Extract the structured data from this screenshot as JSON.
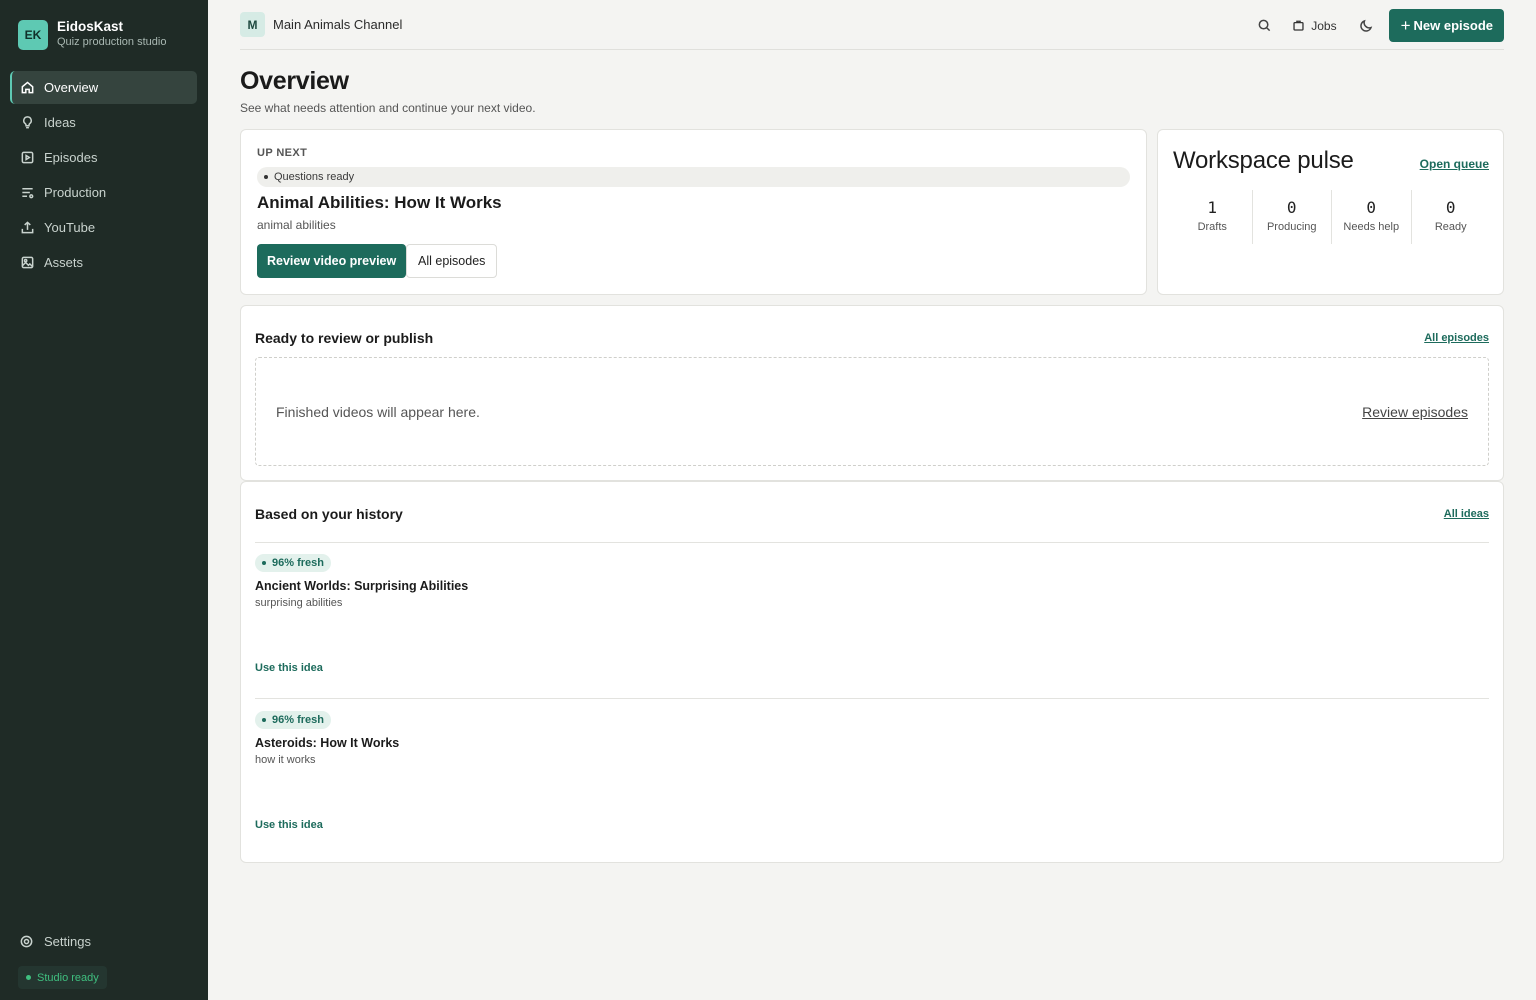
{
  "brand": {
    "initials": "EK",
    "name": "EidosKast",
    "subtitle": "Quiz production studio"
  },
  "sidebar": {
    "items": [
      {
        "label": "Overview",
        "icon": "home-icon",
        "active": true
      },
      {
        "label": "Ideas",
        "icon": "lightbulb-icon"
      },
      {
        "label": "Episodes",
        "icon": "play-square-icon"
      },
      {
        "label": "Production",
        "icon": "list-icon"
      },
      {
        "label": "YouTube",
        "icon": "upload-icon"
      },
      {
        "label": "Assets",
        "icon": "image-icon"
      }
    ],
    "settings_label": "Settings",
    "status_label": "Studio ready"
  },
  "topbar": {
    "channel_initial": "M",
    "channel_name": "Main Animals Channel",
    "jobs_label": "Jobs",
    "new_episode_label": "New episode"
  },
  "header": {
    "title": "Overview",
    "subtitle": "See what needs attention and continue your next video."
  },
  "up_next": {
    "label": "UP NEXT",
    "status": "Questions ready",
    "title": "Animal Abilities: How It Works",
    "topic": "animal abilities",
    "primary_button": "Review video preview",
    "secondary_button": "All episodes"
  },
  "pulse": {
    "title": "Workspace pulse",
    "link": "Open queue",
    "stats": [
      {
        "value": "1",
        "label": "Drafts"
      },
      {
        "value": "0",
        "label": "Producing"
      },
      {
        "value": "0",
        "label": "Needs help"
      },
      {
        "value": "0",
        "label": "Ready"
      }
    ]
  },
  "ready": {
    "title": "Ready to review or publish",
    "link": "All episodes",
    "empty_text": "Finished videos will appear here.",
    "empty_link": "Review episodes"
  },
  "history": {
    "title": "Based on your history",
    "link": "All ideas",
    "ideas": [
      {
        "fresh": "96% fresh",
        "title": "Ancient Worlds: Surprising Abilities",
        "topic": "surprising abilities",
        "action": "Use this idea"
      },
      {
        "fresh": "96% fresh",
        "title": "Asteroids: How It Works",
        "topic": "how it works",
        "action": "Use this idea"
      }
    ]
  },
  "colors": {
    "accent": "#1d6b5c",
    "sidebar_bg": "#1f2b26",
    "status_green": "#3fbf7f"
  }
}
